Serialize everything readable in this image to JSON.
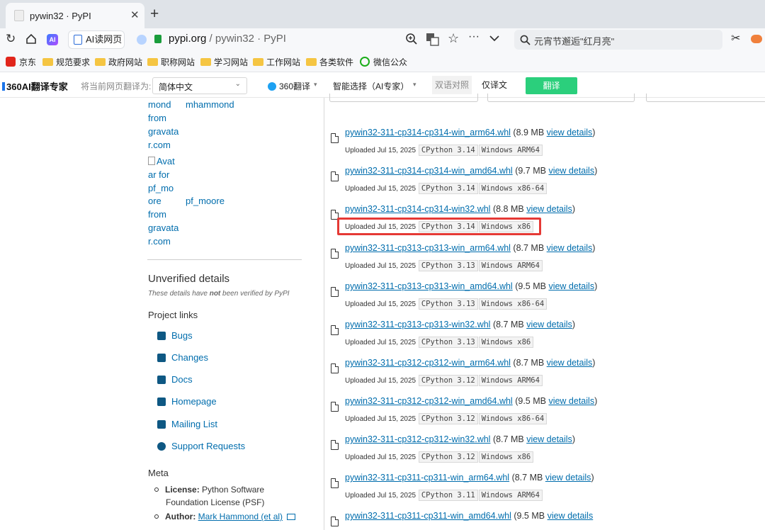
{
  "browser": {
    "tab_title": "pywin32 · PyPI",
    "tab_close": "✕",
    "new_tab": "+",
    "ai_badge": "AI",
    "ai_read_label": "AI读网页",
    "url_host": "pypi.org",
    "url_rest": " / pywin32 · PyPI",
    "search_text": "元宵节邂逅\"红月亮\""
  },
  "bookmarks": [
    "京东",
    "规范要求",
    "政府网站",
    "职称网站",
    "学习网站",
    "工作网站",
    "各类软件",
    "微信公众"
  ],
  "translate_bar": {
    "logo": "360AI翻译专家",
    "label": "将当前网页翻译为:",
    "target_language": "简体中文",
    "engine": "360翻译",
    "mode": "智能选择（AI专家）",
    "compare": "双语对照",
    "only_translation": "仅译文",
    "translate_button": "翻译"
  },
  "sidebar": {
    "maintainer1_alt_lines": [
      "mond",
      "from",
      "gravata",
      "r.com"
    ],
    "maintainer1_name": "mhammond",
    "maintainer2_alt_lines": [
      "Avat",
      "ar for",
      "pf_mo",
      "ore",
      "from",
      "gravata",
      "r.com"
    ],
    "maintainer2_name": "pf_moore",
    "unverified_title": "Unverified details",
    "unverified_note_pre": "These details have ",
    "unverified_note_bold": "not",
    "unverified_note_post": " been verified by PyPI",
    "project_links_title": "Project links",
    "project_links": [
      "Bugs",
      "Changes",
      "Docs",
      "Homepage",
      "Mailing List",
      "Support Requests"
    ],
    "meta_title": "Meta",
    "license_label": "License:",
    "license_value_1": "Python Software",
    "license_value_2": "Foundation License (PSF)",
    "author_label": "Author:",
    "author_value": "Mark Hammond (et al)"
  },
  "files": [
    {
      "name": "pywin32-311-cp314-cp314-win_arm64.whl",
      "size": "(8.9 MB",
      "details": "view details",
      "close": ")",
      "uploaded": "Uploaded Jul 15, 2025",
      "python": "CPython 3.14",
      "platform": "Windows ARM64"
    },
    {
      "name": "pywin32-311-cp314-cp314-win_amd64.whl",
      "size": "(9.7 MB",
      "details": "view details",
      "close": ")",
      "uploaded": "Uploaded Jul 15, 2025",
      "python": "CPython 3.14",
      "platform": "Windows x86-64"
    },
    {
      "name": "pywin32-311-cp314-cp314-win32.whl",
      "size": "(8.8 MB",
      "details": "view details",
      "close": ")",
      "uploaded": "Uploaded Jul 15, 2025",
      "python": "CPython 3.14",
      "platform": "Windows x86"
    },
    {
      "name": "pywin32-311-cp313-cp313-win_arm64.whl",
      "size": "(8.7 MB",
      "details": "view details",
      "close": ")",
      "uploaded": "Uploaded Jul 15, 2025",
      "python": "CPython 3.13",
      "platform": "Windows ARM64"
    },
    {
      "name": "pywin32-311-cp313-cp313-win_amd64.whl",
      "size": "(9.5 MB",
      "details": "view details",
      "close": ")",
      "uploaded": "Uploaded Jul 15, 2025",
      "python": "CPython 3.13",
      "platform": "Windows x86-64"
    },
    {
      "name": "pywin32-311-cp313-cp313-win32.whl",
      "size": "(8.7 MB",
      "details": "view details",
      "close": ")",
      "uploaded": "Uploaded Jul 15, 2025",
      "python": "CPython 3.13",
      "platform": "Windows x86"
    },
    {
      "name": "pywin32-311-cp312-cp312-win_arm64.whl",
      "size": "(8.7 MB",
      "details": "view details",
      "close": ")",
      "uploaded": "Uploaded Jul 15, 2025",
      "python": "CPython 3.12",
      "platform": "Windows ARM64"
    },
    {
      "name": "pywin32-311-cp312-cp312-win_amd64.whl",
      "size": "(9.5 MB",
      "details": "view details",
      "close": ")",
      "uploaded": "Uploaded Jul 15, 2025",
      "python": "CPython 3.12",
      "platform": "Windows x86-64"
    },
    {
      "name": "pywin32-311-cp312-cp312-win32.whl",
      "size": "(8.7 MB",
      "details": "view details",
      "close": ")",
      "uploaded": "Uploaded Jul 15, 2025",
      "python": "CPython 3.12",
      "platform": "Windows x86"
    },
    {
      "name": "pywin32-311-cp311-cp311-win_arm64.whl",
      "size": "(8.7 MB",
      "details": "view details",
      "close": ")",
      "uploaded": "Uploaded Jul 15, 2025",
      "python": "CPython 3.11",
      "platform": "Windows ARM64"
    },
    {
      "name": "pywin32-311-cp311-cp311-win_amd64.whl",
      "size": "(9.5 MB",
      "details": "view details",
      "close": ")",
      "uploaded": "",
      "python": "",
      "platform": ""
    }
  ],
  "highlight_color": "#e53935"
}
